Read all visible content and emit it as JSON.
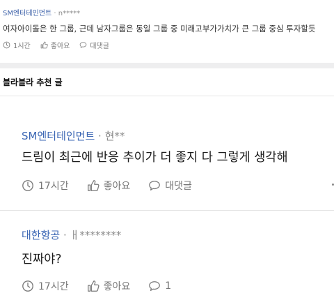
{
  "top_post": {
    "company": "SM엔터테인먼트",
    "author": "· n*****",
    "body": "여자아이돌은 한 그룹, 근데 남자그룹은 동일 그룹 중 미래고부가가치가 큰 그룹 중심 투자할듯",
    "time": "1시간",
    "like_label": "좋아요",
    "comment_label": "대댓글"
  },
  "section": {
    "title": "블라블라 추천 글"
  },
  "posts": [
    {
      "company": "SM엔터테인먼트",
      "author": "· 현**",
      "body": "드림이 최근에 반응 추이가 더 좋지 다 그렇게 생각해",
      "time": "17시간",
      "like_label": "좋아요",
      "comment_label": "대댓글"
    },
    {
      "company": "대한항공",
      "author": "· ㅐ********",
      "body": "진짜야?",
      "time": "17시간",
      "like_label": "좋아요",
      "comment_label": "1"
    }
  ],
  "icons": {
    "time": "clock-icon",
    "like": "thumbs-up-icon",
    "comment": "speech-bubble-icon",
    "more": "more-options-icon"
  },
  "colors": {
    "company": "#3c67b4",
    "meta": "#8a8a8a",
    "band": "#eeeeef"
  }
}
